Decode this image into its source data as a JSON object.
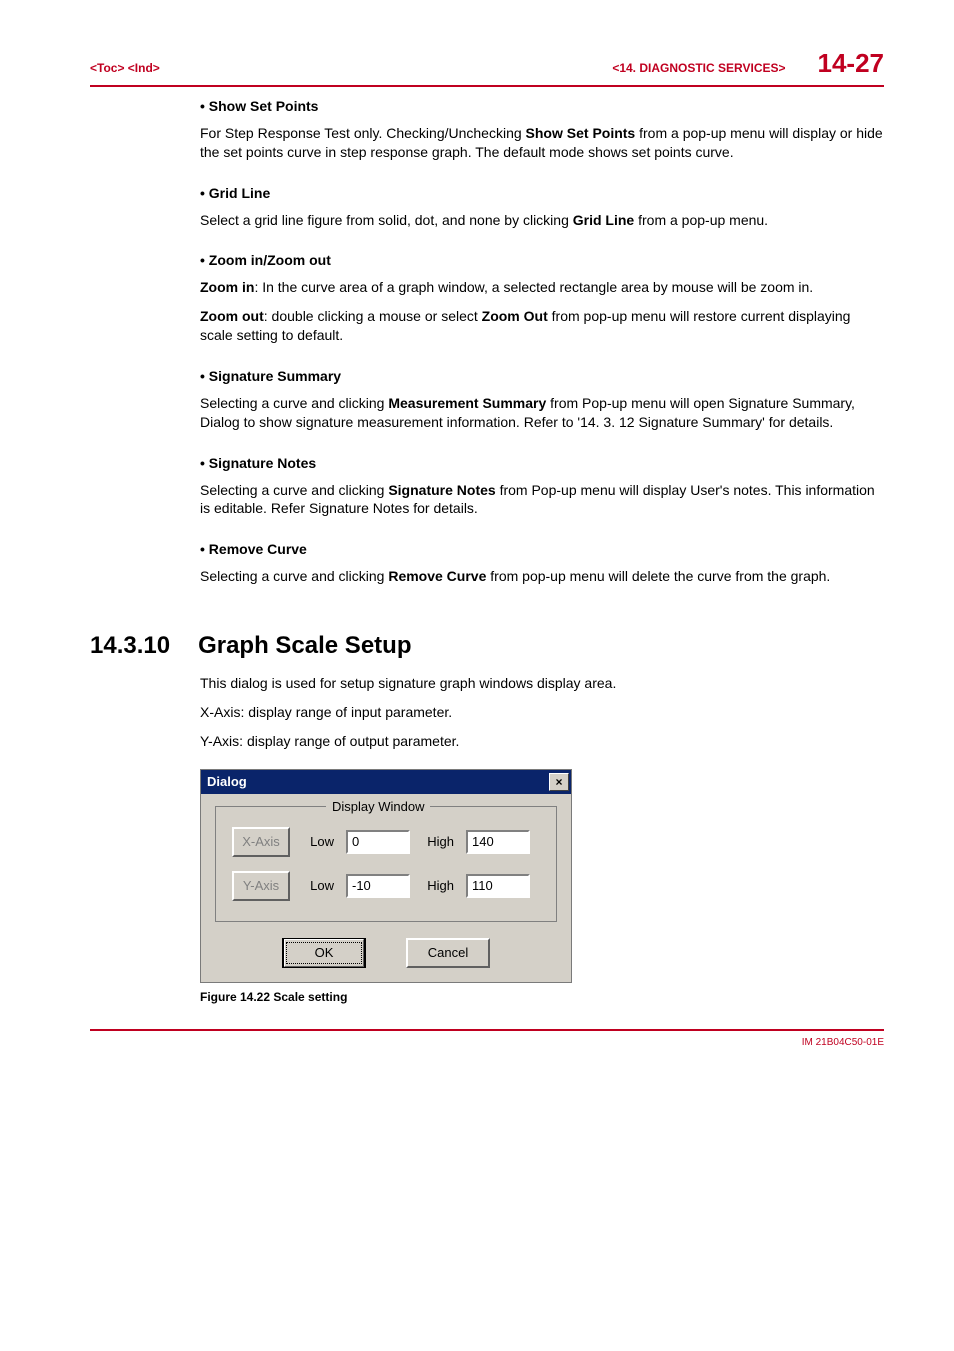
{
  "header": {
    "left": "<Toc> <Ind>",
    "section": "<14.  DIAGNOSTIC SERVICES>",
    "page": "14-27"
  },
  "sections": {
    "showSetPoints": {
      "title": "Show Set Points",
      "body_pre": "For Step Response Test only. Checking/Unchecking  ",
      "body_bold": "Show Set Points",
      "body_post": "  from a pop-up menu will display or hide the set points curve in step response graph.  The default mode shows set points curve."
    },
    "gridLine": {
      "title": "Grid Line",
      "body_pre": "Select a grid line figure from solid, dot, and none by clicking ",
      "body_bold": "Grid Line",
      "body_post": " from a pop-up menu."
    },
    "zoom": {
      "title": "Zoom in/Zoom out",
      "p1_b": "Zoom in",
      "p1": ": In the curve area of a graph window, a selected rectangle area  by mouse will be zoom in.",
      "p2_b1": "Zoom out",
      "p2_mid": ": double clicking a mouse or select ",
      "p2_b2": "Zoom Out",
      "p2_post": "  from pop-up menu will restore current displaying scale setting to default."
    },
    "sigSummary": {
      "title": "Signature Summary",
      "body_pre": "Selecting a curve and clicking ",
      "body_bold": "Measurement Summary",
      "body_post": "  from Pop-up menu will open Signature Summary, Dialog to show signature measurement information. Refer to '14. 3. 12 Signature Summary' for details."
    },
    "sigNotes": {
      "title": "Signature Notes",
      "body_pre": "Selecting a curve and clicking ",
      "body_bold": "Signature Notes",
      "body_post": " from Pop-up menu will display User's notes.  This information is editable. Refer Signature Notes for details."
    },
    "removeCurve": {
      "title": "Remove Curve",
      "body_pre": "Selecting a curve and clicking ",
      "body_bold": "Remove Curve",
      "body_post": " from pop-up menu will delete the curve from the graph."
    }
  },
  "h2": {
    "num": "14.3.10",
    "title": "Graph Scale Setup",
    "p1": "This dialog is used for setup signature graph windows display area.",
    "p2": "X-Axis: display range of input parameter.",
    "p3": "Y-Axis: display range of output parameter."
  },
  "dialog": {
    "title": "Dialog",
    "close": "×",
    "group": "Display Window",
    "xaxis_btn": "X-Axis",
    "yaxis_btn": "Y-Axis",
    "low_label": "Low",
    "high_label": "High",
    "x_low": "0",
    "x_high": "140",
    "y_low": "-10",
    "y_high": "110",
    "ok": "OK",
    "cancel": "Cancel"
  },
  "figure_caption": "Figure 14.22  Scale setting",
  "footer": "IM 21B04C50-01E"
}
